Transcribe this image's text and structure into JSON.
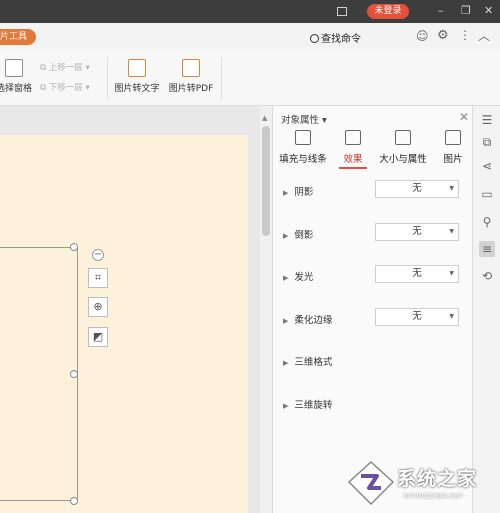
{
  "titlebar": {
    "login_label": "未登录"
  },
  "tabrow": {
    "tool_tab": "片工具",
    "search_label": "查找命令"
  },
  "ribbon": {
    "select_pane": "选择窗格",
    "bring_forward": "上移一层",
    "send_backward": "下移一层",
    "img_to_text": "图片转文字",
    "img_to_pdf": "图片转PDF"
  },
  "panel": {
    "title": "对象属性",
    "tabs": [
      {
        "label": "填充与线条",
        "icon": "fill-line-icon"
      },
      {
        "label": "效果",
        "icon": "effect-icon",
        "active": true
      },
      {
        "label": "大小与属性",
        "icon": "size-icon"
      },
      {
        "label": "图片",
        "icon": "picture-icon"
      }
    ],
    "rows": [
      {
        "label": "阴影",
        "value": "无"
      },
      {
        "label": "倒影",
        "value": "无"
      },
      {
        "label": "发光",
        "value": "无"
      },
      {
        "label": "柔化边缘",
        "value": "无"
      },
      {
        "label": "三维格式"
      },
      {
        "label": "三维旋转"
      }
    ]
  },
  "watermark": {
    "text": "系统之家",
    "sub": "XITONGZHIJIA.NET"
  },
  "colors": {
    "accent": "#e2513a",
    "slide_bg": "#fdf1dc",
    "titlebar_bg": "#3d3d3d"
  }
}
